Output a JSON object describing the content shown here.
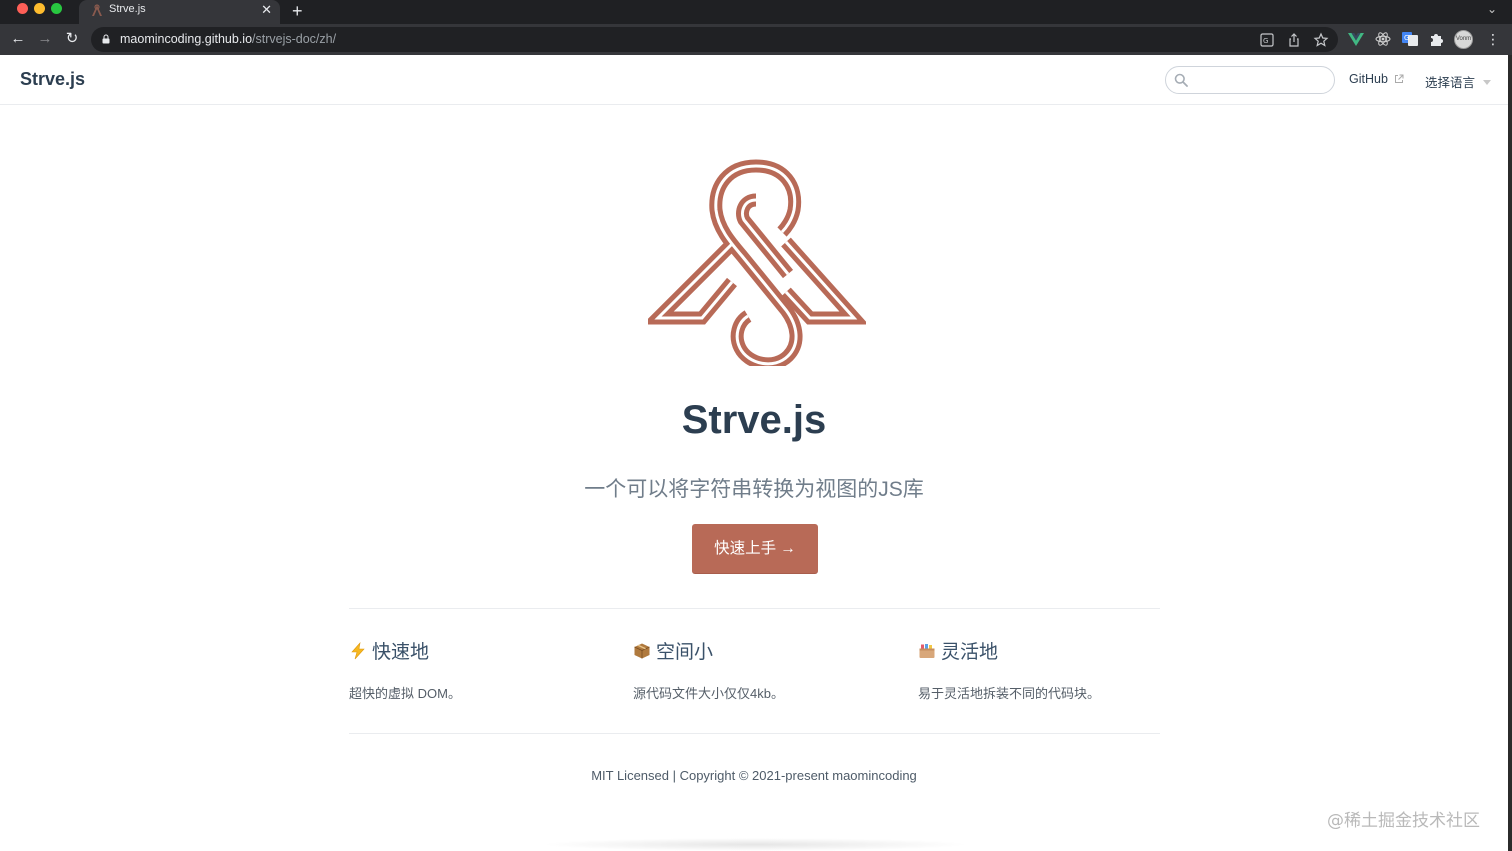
{
  "browser": {
    "tab_title": "Strve.js",
    "url_host": "maomincoding.github.io",
    "url_path": "/strvejs-doc/zh/",
    "avatar_label": "Vonm"
  },
  "site": {
    "title": "Strve.js",
    "search_placeholder": "",
    "nav_github": "GitHub",
    "nav_language": "选择语言"
  },
  "hero": {
    "title": "Strve.js",
    "description": "一个可以将字符串转换为视图的JS库",
    "action_label": "快速上手 →"
  },
  "features": [
    {
      "icon": "lightning-icon",
      "title": "快速地",
      "text": "超快的虚拟 DOM。"
    },
    {
      "icon": "package-icon",
      "title": "空间小",
      "text": "源代码文件大小仅仅4kb。"
    },
    {
      "icon": "card-box-icon",
      "title": "灵活地",
      "text": "易于灵活地拆装不同的代码块。"
    }
  ],
  "footer": "MIT Licensed | Copyright © 2021-present maomincoding",
  "watermark": "@稀土掘金技术社区",
  "colors": {
    "brand": "#b86a57",
    "text": "#2c3e50"
  }
}
